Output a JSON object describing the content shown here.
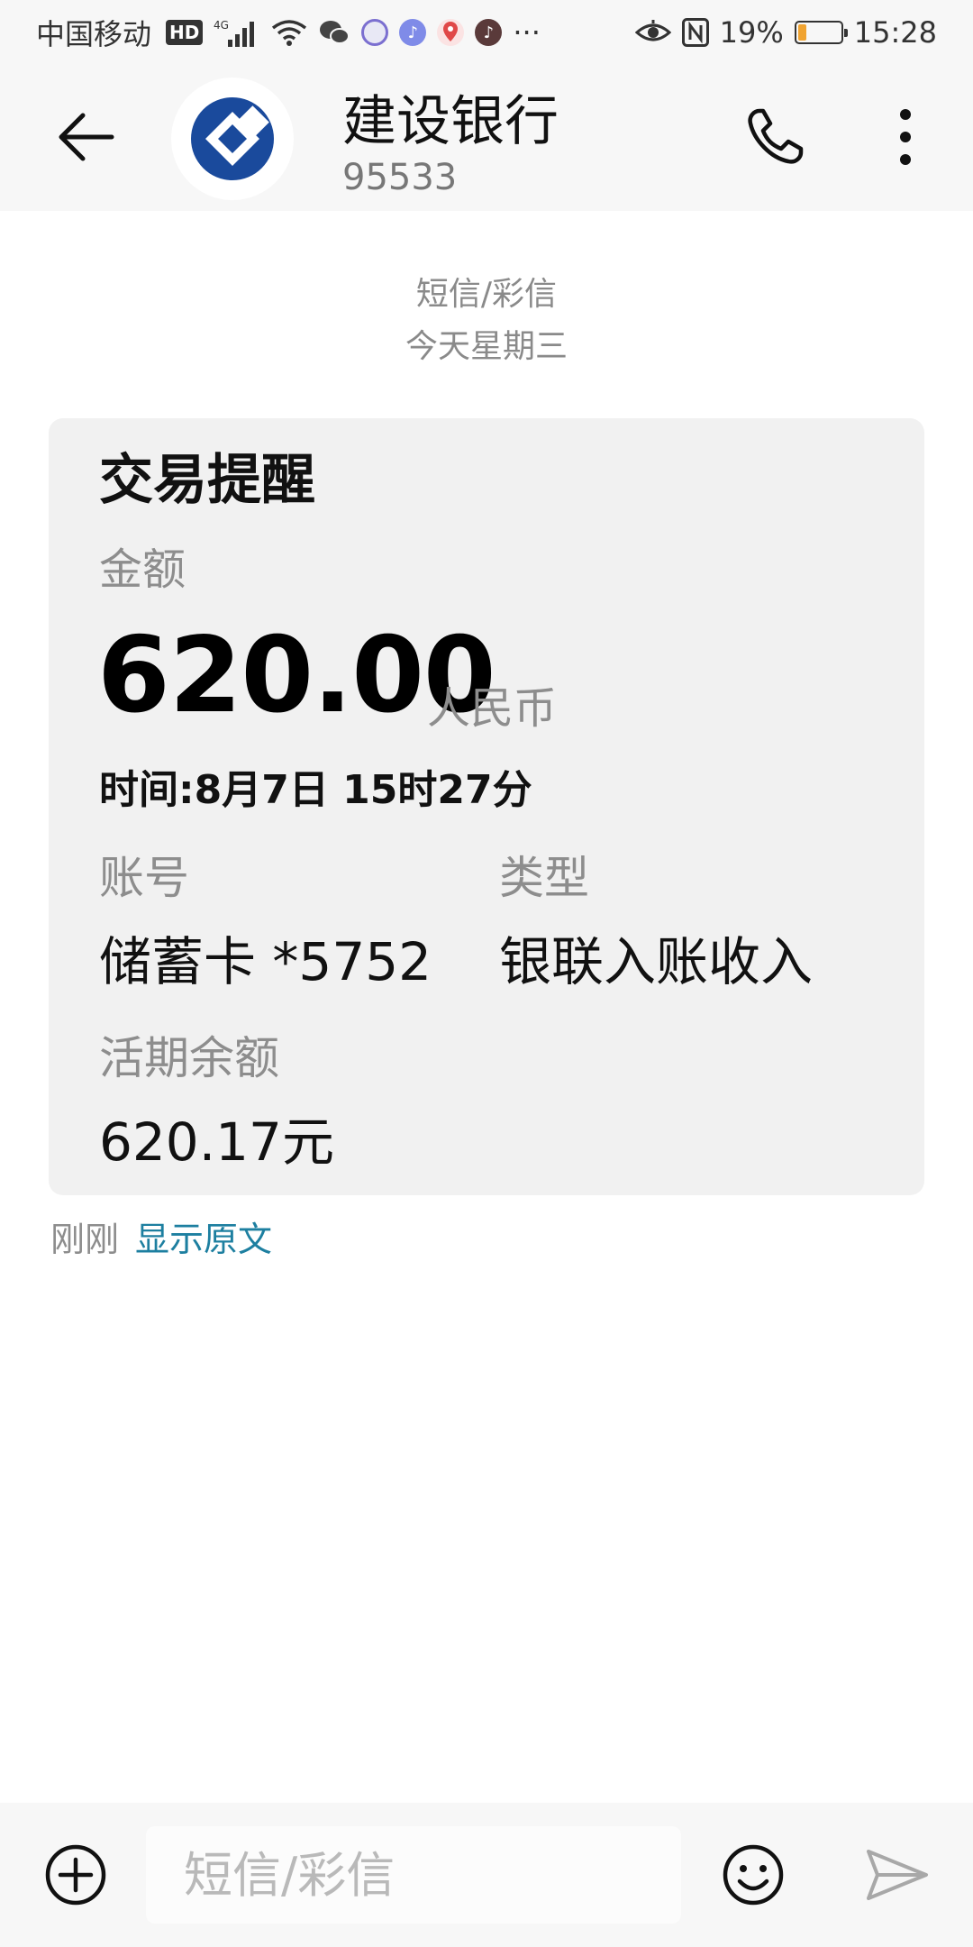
{
  "status_bar": {
    "carrier": "中国移动",
    "hd_badge": "HD",
    "network": "4G",
    "more_notifications": "···",
    "battery_percent": "19%",
    "battery_level": 0.19,
    "time": "15:28"
  },
  "header": {
    "contact_name": "建设银行",
    "contact_number": "95533"
  },
  "conversation": {
    "message_type": "短信/彩信",
    "date": "今天星期三"
  },
  "message": {
    "title": "交易提醒",
    "amount_label": "金额",
    "amount": "620.00",
    "currency": "人民币",
    "time": "时间:8月7日 15时27分",
    "account_label": "账号",
    "account_value": "储蓄卡 *5752",
    "type_label": "类型",
    "type_value": "银联入账收入",
    "balance_label": "活期余额",
    "balance_value": "620.17元",
    "sent_time": "刚刚",
    "show_original": "显示原文"
  },
  "input": {
    "placeholder": "短信/彩信"
  },
  "colors": {
    "link": "#1d7fa0",
    "bank_blue": "#1a4a9c",
    "bar_background": "#f7f7f7",
    "card_background": "#f1f1f1"
  },
  "icons": {
    "back": "back-arrow-icon",
    "call": "phone-icon",
    "more": "more-vertical-icon",
    "add": "plus-circle-icon",
    "emoji": "emoji-icon",
    "send": "send-icon"
  }
}
